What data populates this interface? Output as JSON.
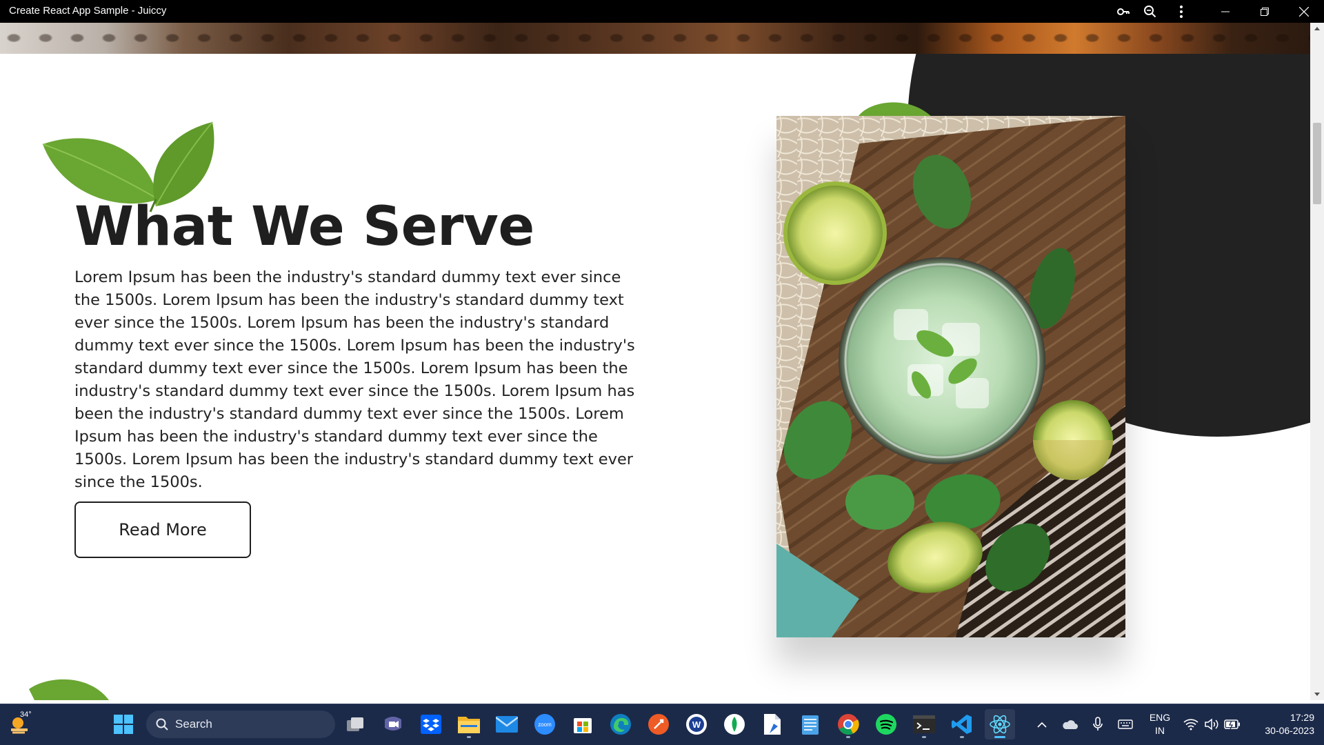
{
  "window": {
    "title": "Create React App Sample - Juiccy",
    "controls": [
      "key-icon",
      "zoom-icon",
      "more-icon",
      "minimize-icon",
      "restore-icon",
      "close-icon"
    ]
  },
  "section": {
    "title": "What We Serve",
    "body": "Lorem Ipsum has been the industry's standard dummy text ever since the 1500s. Lorem Ipsum has been the industry's standard dummy text ever since the 1500s. Lorem Ipsum has been the industry's standard dummy text ever since the 1500s. Lorem Ipsum has been the industry's standard dummy text ever since the 1500s. Lorem Ipsum has been the industry's standard dummy text ever since the 1500s. Lorem Ipsum has been the industry's standard dummy text ever since the 1500s. Lorem Ipsum has been the industry's standard dummy text ever since the 1500s. Lorem Ipsum has been the industry's standard dummy text ever since the 1500s.",
    "button_label": "Read More"
  },
  "colors": {
    "dark_circle": "#222222",
    "text": "#1f1f1f",
    "leaf": "#6aa632",
    "taskbar": "#1c2a4a"
  },
  "taskbar": {
    "weather_temp": "34°",
    "search_label": "Search",
    "apps": [
      "start-icon",
      "search-icon",
      "task-view-icon",
      "teams-icon",
      "dropbox-icon",
      "file-explorer-icon",
      "mail-icon",
      "zoom-icon",
      "store-icon",
      "edge-icon",
      "postman-icon",
      "app-w-icon",
      "mongodb-icon",
      "file-pdf-icon",
      "notepad-icon",
      "chrome-icon",
      "spotify-icon",
      "terminal-icon",
      "vscode-icon",
      "react-devtools-icon"
    ],
    "tray": {
      "lang_line1": "ENG",
      "lang_line2": "IN",
      "time": "17:29",
      "date": "30-06-2023"
    }
  }
}
